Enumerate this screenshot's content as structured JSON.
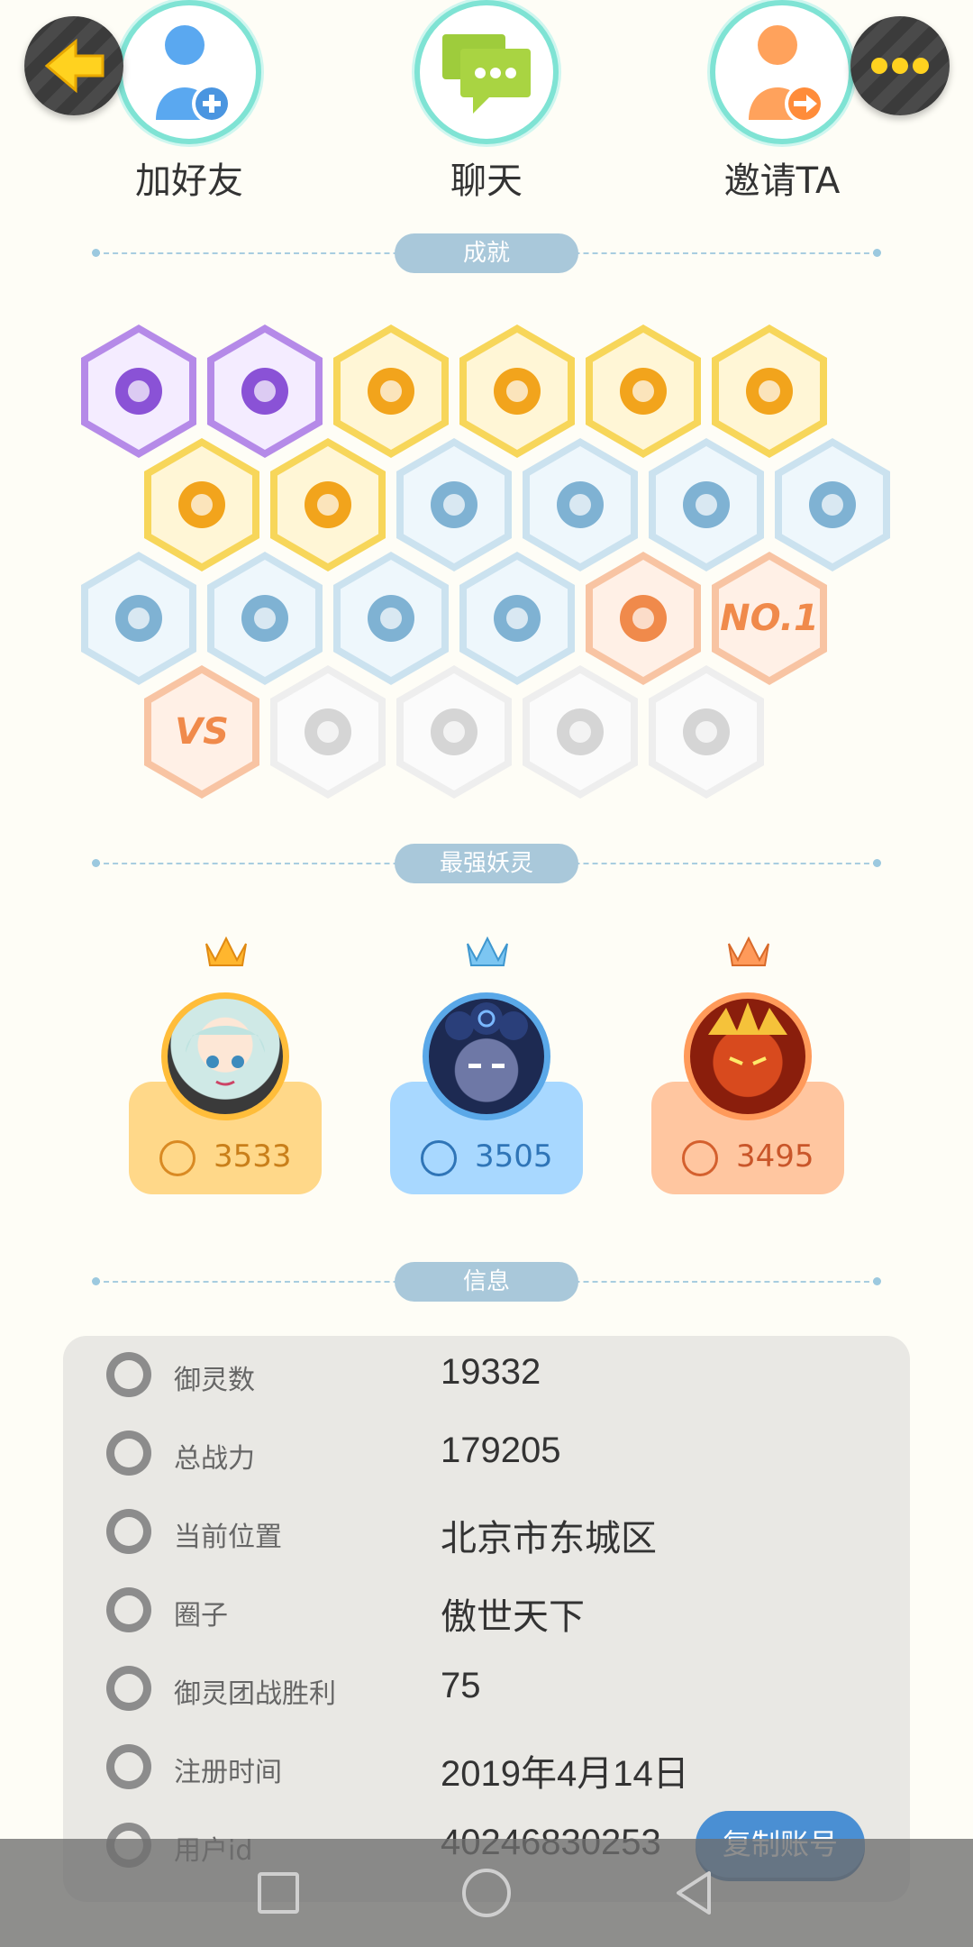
{
  "top_buttons": {
    "back_icon": "arrow-left-icon",
    "more_icon": "ellipsis-icon"
  },
  "actions": [
    {
      "label": "加好友",
      "icon": "add-friend-icon"
    },
    {
      "label": "聊天",
      "icon": "chat-icon"
    },
    {
      "label": "邀请TA",
      "icon": "invite-icon"
    }
  ],
  "sections": {
    "achievements": "成就",
    "top_spirits": "最强妖灵",
    "info": "信息"
  },
  "badges": [
    {
      "row": 0,
      "color": "purple",
      "icon": "devil-face-icon"
    },
    {
      "row": 0,
      "color": "purple",
      "icon": "yin-yang-swirl-icon"
    },
    {
      "row": 0,
      "color": "gold",
      "icon": "sun-pin-icon"
    },
    {
      "row": 0,
      "color": "gold",
      "icon": "golden-dome-icon"
    },
    {
      "row": 0,
      "color": "gold",
      "icon": "dancing-fox-icon"
    },
    {
      "row": 0,
      "color": "gold",
      "icon": "taiji-book-icon"
    },
    {
      "row": 1,
      "color": "gold",
      "icon": "golden-dragon-icon"
    },
    {
      "row": 1,
      "color": "gold",
      "icon": "golden-blob-icon"
    },
    {
      "row": 1,
      "color": "blue",
      "icon": "sneaker-icon"
    },
    {
      "row": 1,
      "color": "blue",
      "icon": "moon-planet-icon"
    },
    {
      "row": 1,
      "color": "blue",
      "icon": "crystal-shield-icon"
    },
    {
      "row": 1,
      "color": "blue",
      "icon": "spirit-figure-icon"
    },
    {
      "row": 2,
      "color": "blue",
      "icon": "cat-stroller-icon"
    },
    {
      "row": 2,
      "color": "blue",
      "icon": "target-shield-icon"
    },
    {
      "row": 2,
      "color": "blue",
      "icon": "cat-silhouettes-icon"
    },
    {
      "row": 2,
      "color": "blue",
      "icon": "fox-book-icon"
    },
    {
      "row": 2,
      "color": "orange",
      "icon": "demon-pedestal-icon"
    },
    {
      "row": 2,
      "color": "orange",
      "icon": "no1-icon",
      "text": "NO.1"
    },
    {
      "row": 3,
      "color": "orange",
      "icon": "vs-icon",
      "text": "VS"
    },
    {
      "row": 3,
      "color": "grey",
      "icon": "lion-emblem-icon"
    },
    {
      "row": 3,
      "color": "grey",
      "icon": "crossed-swords-icon"
    },
    {
      "row": 3,
      "color": "grey",
      "icon": "hearts-couple-icon"
    },
    {
      "row": 3,
      "color": "grey",
      "icon": "cat-list-icon"
    }
  ],
  "top_spirits": [
    {
      "power": "3533",
      "crown": "gold",
      "avatar": "silver-hair-girl"
    },
    {
      "power": "3505",
      "crown": "blue",
      "avatar": "blue-curly-boy"
    },
    {
      "power": "3495",
      "crown": "orange",
      "avatar": "fire-demon"
    }
  ],
  "info": [
    {
      "key": "御灵数",
      "value": "19332",
      "icon": "spirit-count-icon"
    },
    {
      "key": "总战力",
      "value": "179205",
      "icon": "sword-power-icon"
    },
    {
      "key": "当前位置",
      "value": "北京市东城区",
      "icon": "location-pin-icon"
    },
    {
      "key": "圈子",
      "value": "傲世天下",
      "icon": "circle-target-icon"
    },
    {
      "key": "御灵团战胜利",
      "value": "75",
      "icon": "team-victory-icon"
    },
    {
      "key": "注册时间",
      "value": "2019年4月14日",
      "icon": "clock-icon"
    },
    {
      "key": "用户id",
      "value": "40246830253",
      "icon": "user-id-icon"
    }
  ],
  "copy_button": "复制账号",
  "navbar": {
    "recent": "recent-apps-icon",
    "home": "home-icon",
    "back": "back-triangle-icon"
  }
}
